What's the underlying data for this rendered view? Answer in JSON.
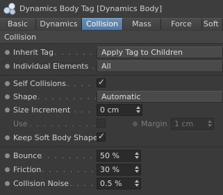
{
  "window": {
    "title": "Dynamics Body Tag [Dynamics Body]"
  },
  "tabs": [
    {
      "label": "Basic"
    },
    {
      "label": "Dynamics"
    },
    {
      "label": "Collision",
      "active": true
    },
    {
      "label": "Mass"
    },
    {
      "label": "Force"
    },
    {
      "label": "Soft B"
    }
  ],
  "section": {
    "title": "Collision"
  },
  "fields": {
    "inherit_tag": {
      "label": "Inherit Tag",
      "leader": ". . . . . . . . . .",
      "value": "Apply Tag to Children"
    },
    "individual_elements": {
      "label": "Individual Elements",
      "leader": ". .",
      "value": "All"
    },
    "self_collisions": {
      "label": "Self Collisions",
      "leader": ". . . . . .",
      "checked": true,
      "check_glyph": "✓"
    },
    "shape": {
      "label": "Shape",
      "leader": ". . . . . . . . . . . . .",
      "value": "Automatic"
    },
    "size_increment": {
      "label": "Size Increment",
      "leader": ". . . . . . .",
      "value": "0 cm"
    },
    "use": {
      "label": "Use",
      "leader": ". . . . . . . . . . . . . . .",
      "checked": false
    },
    "margin": {
      "label": "Margin",
      "value": "1 cm"
    },
    "keep_soft_body_shape": {
      "label": "Keep Soft Body Shape",
      "checked": true,
      "check_glyph": "✓"
    },
    "bounce": {
      "label": "Bounce",
      "leader": ". . . . . . . . . . . . .",
      "value": "50 %"
    },
    "friction": {
      "label": "Friction",
      "leader": ". . . . . . . . . . . . .",
      "value": "30 %"
    },
    "collision_noise": {
      "label": "Collision Noise",
      "leader": ". . . . . .",
      "value": "0.5 %"
    }
  },
  "colors": {
    "background": "#3a3a3a",
    "active_tab": "#5f86b0",
    "text": "#cfcfcf"
  }
}
